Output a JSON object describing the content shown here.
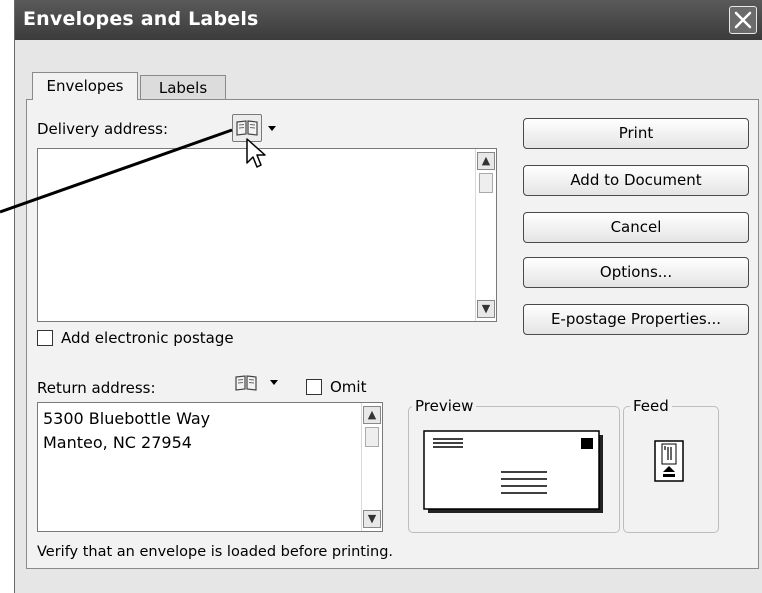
{
  "window": {
    "title": "Envelopes and Labels"
  },
  "tabs": [
    {
      "label": "Envelopes",
      "active": true
    },
    {
      "label": "Labels",
      "active": false
    }
  ],
  "delivery": {
    "label": "Delivery address:",
    "value": ""
  },
  "buttons": {
    "print": "Print",
    "add_to_document": "Add to Document",
    "cancel": "Cancel",
    "options": "Options...",
    "epostage": "E-postage Properties..."
  },
  "electronic_postage": {
    "label": "Add electronic postage",
    "checked": false
  },
  "return": {
    "label": "Return address:",
    "omit_label": "Omit",
    "omit_checked": false,
    "lines": [
      "5300 Bluebottle Way",
      "Manteo, NC 27954"
    ]
  },
  "preview": {
    "label": "Preview"
  },
  "feed": {
    "label": "Feed"
  },
  "status": "Verify that an envelope is loaded before printing.",
  "icons": [
    "address-book-icon",
    "dropdown-arrow-icon",
    "close-icon",
    "mouse-pointer-icon",
    "scroll-up-icon",
    "scroll-down-icon",
    "envelope-preview-icon",
    "feed-tray-icon"
  ],
  "colors": {
    "titlebar": "#4a4a4a",
    "dialog_bg": "#e6e6e6",
    "panel_bg": "#f2f2f2"
  }
}
